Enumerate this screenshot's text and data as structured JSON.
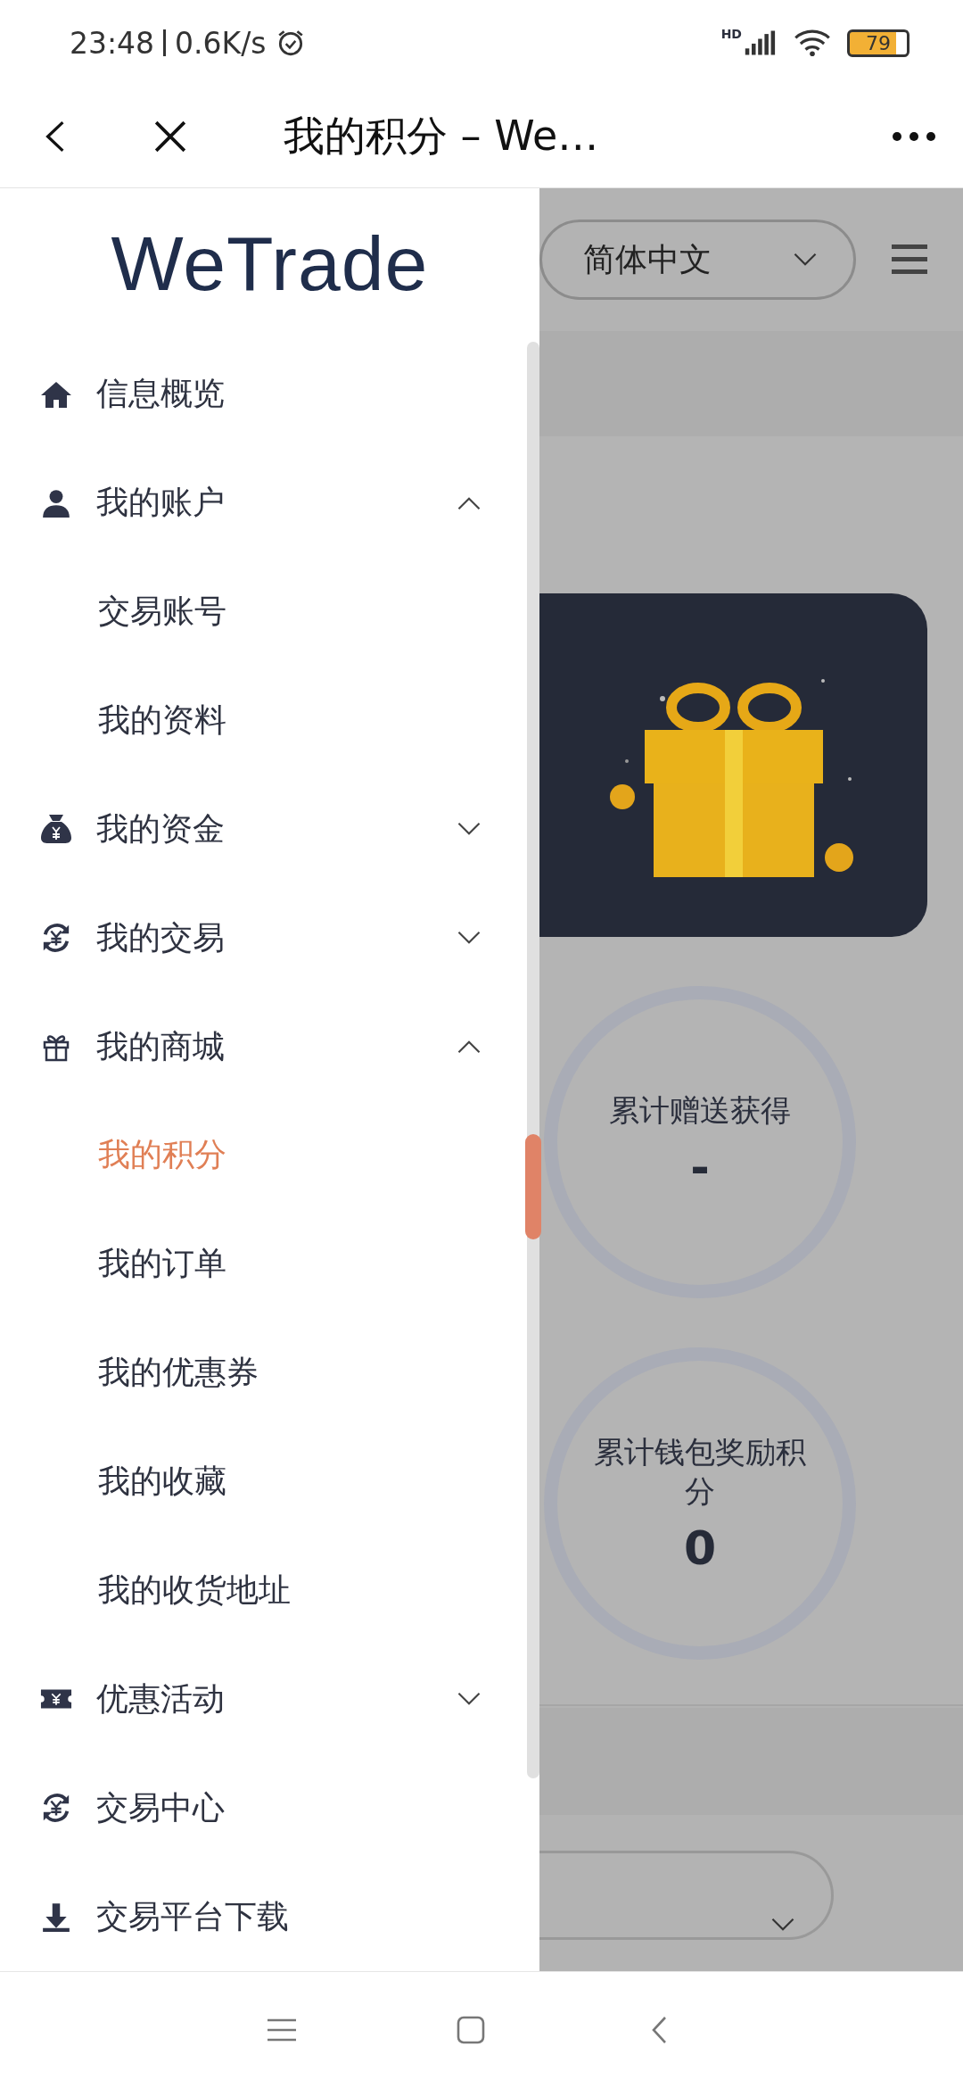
{
  "status_bar": {
    "time": "23:48",
    "speed": "0.6K/s",
    "network": "HD",
    "battery": "79"
  },
  "header": {
    "title": "我的积分 – We…"
  },
  "drawer": {
    "logo": "WeTrade",
    "items": [
      {
        "label": "信息概览",
        "selected": false
      },
      {
        "label": "我的账户",
        "selected": false,
        "expanded": true,
        "children": [
          {
            "label": "交易账号",
            "selected": false
          },
          {
            "label": "我的资料",
            "selected": false
          }
        ]
      },
      {
        "label": "我的资金",
        "selected": false,
        "expanded": false
      },
      {
        "label": "我的交易",
        "selected": false,
        "expanded": false
      },
      {
        "label": "我的商城",
        "selected": false,
        "expanded": true,
        "children": [
          {
            "label": "我的积分",
            "selected": true
          },
          {
            "label": "我的订单",
            "selected": false
          },
          {
            "label": "我的优惠券",
            "selected": false
          },
          {
            "label": "我的收藏",
            "selected": false
          },
          {
            "label": "我的收货地址",
            "selected": false
          }
        ]
      },
      {
        "label": "优惠活动",
        "selected": false,
        "expanded": false
      },
      {
        "label": "交易中心",
        "selected": false
      },
      {
        "label": "交易平台下载",
        "selected": false
      }
    ]
  },
  "page": {
    "language": "简体中文",
    "stats": [
      {
        "label": "累计赠送获得",
        "value": "-"
      },
      {
        "label": "累计钱包奖励积分",
        "value": "0"
      }
    ]
  }
}
